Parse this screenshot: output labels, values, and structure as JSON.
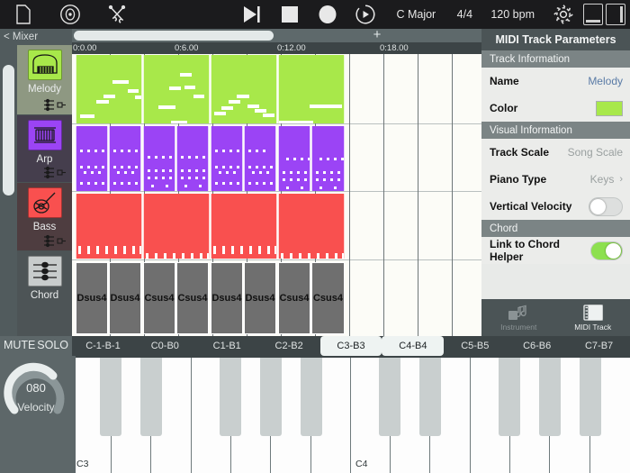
{
  "toolbar": {
    "icons": [
      "file-icon",
      "disc-icon",
      "tools-icon"
    ],
    "transport": [
      "play-to-end-icon",
      "stop-icon",
      "record-icon",
      "loop-play-icon"
    ],
    "key": "C Major",
    "time_signature": "4/4",
    "tempo": "120 bpm",
    "gear": "gear-icon",
    "panel_buttons": [
      "panel-bottom-icon",
      "panel-right-icon"
    ]
  },
  "sidebar": {
    "mixer_label": "< Mixer",
    "tracks": [
      {
        "name": "Melody",
        "icon": "grand-piano-icon",
        "color": "#a8e84a",
        "row_bg": "#8e9882"
      },
      {
        "name": "Arp",
        "icon": "synth-icon",
        "color": "#9b44f5",
        "row_bg": "#453e4d"
      },
      {
        "name": "Bass",
        "icon": "bass-guitar-icon",
        "color": "#f9504f",
        "row_bg": "#4e3d40"
      },
      {
        "name": "Chord",
        "icon": "staff-notes-icon",
        "color": "#c8cccc",
        "row_bg": "#4d5456"
      }
    ]
  },
  "timeline": {
    "ruler_marks": [
      "0:0.00",
      "0:6.00",
      "0:12.00",
      "0:18.00"
    ],
    "add_button": "+"
  },
  "chord_track": {
    "clips": [
      "Dsus4",
      "Dsus4",
      "Csus4",
      "Csus4",
      "Dsus4",
      "Dsus4",
      "Csus4",
      "Csus4"
    ]
  },
  "panel": {
    "title": "MIDI Track Parameters",
    "sections": [
      {
        "heading": "Track Information",
        "rows": [
          {
            "key": "Name",
            "value": "Melody",
            "type": "link"
          },
          {
            "key": "Color",
            "value": "#a8e84a",
            "type": "swatch"
          }
        ]
      },
      {
        "heading": "Visual Information",
        "rows": [
          {
            "key": "Track Scale",
            "value": "Song Scale",
            "type": "dim"
          },
          {
            "key": "Piano Type",
            "value": "Keys",
            "type": "dim-chevron"
          },
          {
            "key": "Vertical Velocity",
            "value": "off",
            "type": "toggle"
          }
        ]
      },
      {
        "heading": "Chord",
        "rows": [
          {
            "key": "Link to Chord Helper",
            "value": "on",
            "type": "toggle"
          }
        ]
      }
    ],
    "tabs": [
      {
        "label": "Instrument",
        "icon": "instrument-icon",
        "active": false
      },
      {
        "label": "MIDI Track",
        "icon": "midi-track-icon",
        "active": true
      }
    ],
    "toggle_on_color": "#8de04f"
  },
  "bottom": {
    "mute_label": "MUTE",
    "solo_label": "SOLO",
    "knob_value": "080",
    "knob_label": "Velocity",
    "octaves": [
      {
        "label": "C-1-B-1",
        "selected": false
      },
      {
        "label": "C0-B0",
        "selected": false
      },
      {
        "label": "C1-B1",
        "selected": false
      },
      {
        "label": "C2-B2",
        "selected": false
      },
      {
        "label": "C3-B3",
        "selected": true
      },
      {
        "label": "C4-B4",
        "selected": true
      },
      {
        "label": "C5-B5",
        "selected": false
      },
      {
        "label": "C6-B6",
        "selected": false
      },
      {
        "label": "C7-B7",
        "selected": false
      }
    ],
    "key_labels": [
      "C3",
      "C4"
    ]
  }
}
